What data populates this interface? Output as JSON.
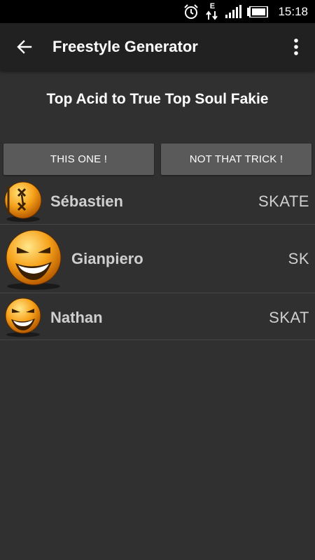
{
  "status_bar": {
    "time": "15:18",
    "network_type": "E",
    "icons": [
      "alarm-icon",
      "data-arrows-icon",
      "signal-icon",
      "battery-icon"
    ]
  },
  "app_bar": {
    "title": "Freestyle Generator",
    "back_icon": "arrow-back-icon",
    "menu_icon": "more-vert-icon"
  },
  "trick": {
    "name": "Top Acid to True Top Soul Fakie"
  },
  "buttons": {
    "accept_label": "THIS ONE !",
    "reject_label": "NOT THAT TRICK !"
  },
  "players": [
    {
      "name": "Sébastien",
      "score": "SKATE",
      "avatar": "knocked-out-smiley-icon"
    },
    {
      "name": "Gianpiero",
      "score": "SK",
      "avatar": "evil-grin-smiley-icon"
    },
    {
      "name": "Nathan",
      "score": "SKAT",
      "avatar": "evil-grin-smiley-icon"
    }
  ],
  "colors": {
    "background": "#303030",
    "app_bar": "#212121",
    "button": "#5a5a5a",
    "avatar_orange": "#f7a21b"
  }
}
